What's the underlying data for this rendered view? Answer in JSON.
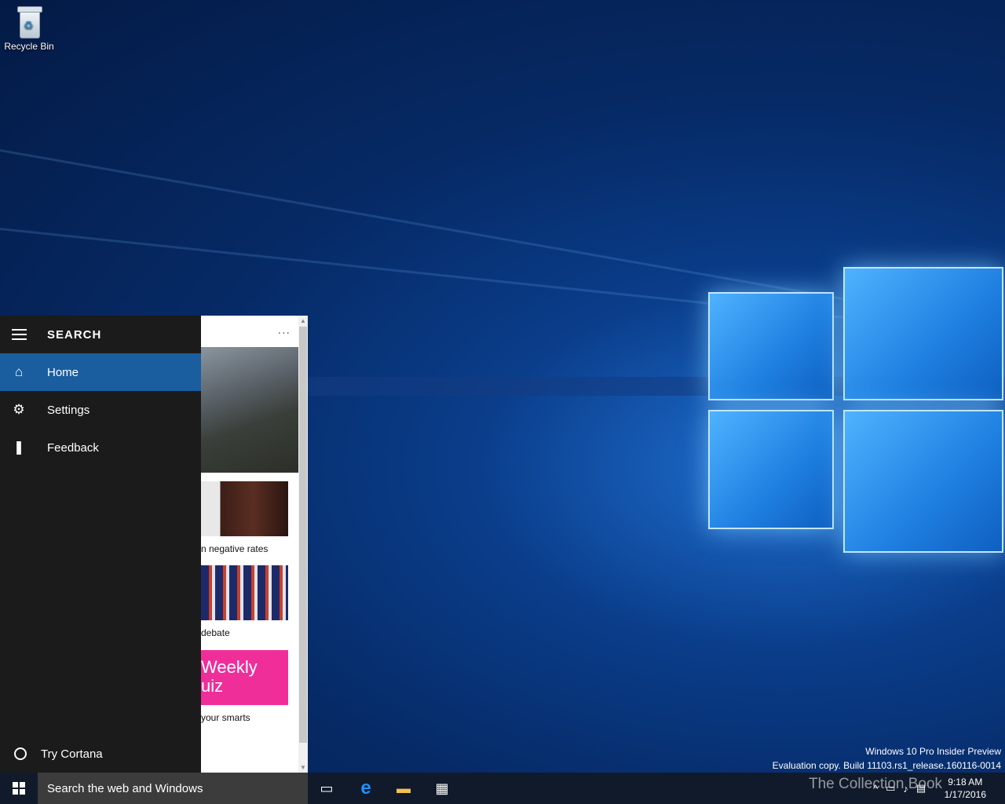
{
  "desktop": {
    "recycle_bin_label": "Recycle Bin"
  },
  "search_panel": {
    "title": "SEARCH",
    "nav": [
      {
        "label": "Home",
        "icon": "home-icon",
        "active": true
      },
      {
        "label": "Settings",
        "icon": "gear-icon",
        "active": false
      },
      {
        "label": "Feedback",
        "icon": "feedback-icon",
        "active": false
      }
    ],
    "cortana_label": "Try Cortana",
    "more_label": "...",
    "cards": [
      {
        "caption": "n negative rates"
      },
      {
        "caption": "debate"
      },
      {
        "caption": "your smarts",
        "quiz_text": "Weekly uiz"
      }
    ]
  },
  "watermark": {
    "line1": "Windows 10 Pro Insider Preview",
    "line2": "Evaluation copy. Build 11103.rs1_release.160116-0014"
  },
  "taskbar": {
    "search_placeholder": "Search the web and Windows",
    "time": "9:18 AM",
    "date": "1/17/2016",
    "brand_text": "The Collection Book"
  },
  "colors": {
    "accent": "#1b5ea0",
    "panel": "#1b1b1b",
    "taskbar": "#101a2a"
  }
}
